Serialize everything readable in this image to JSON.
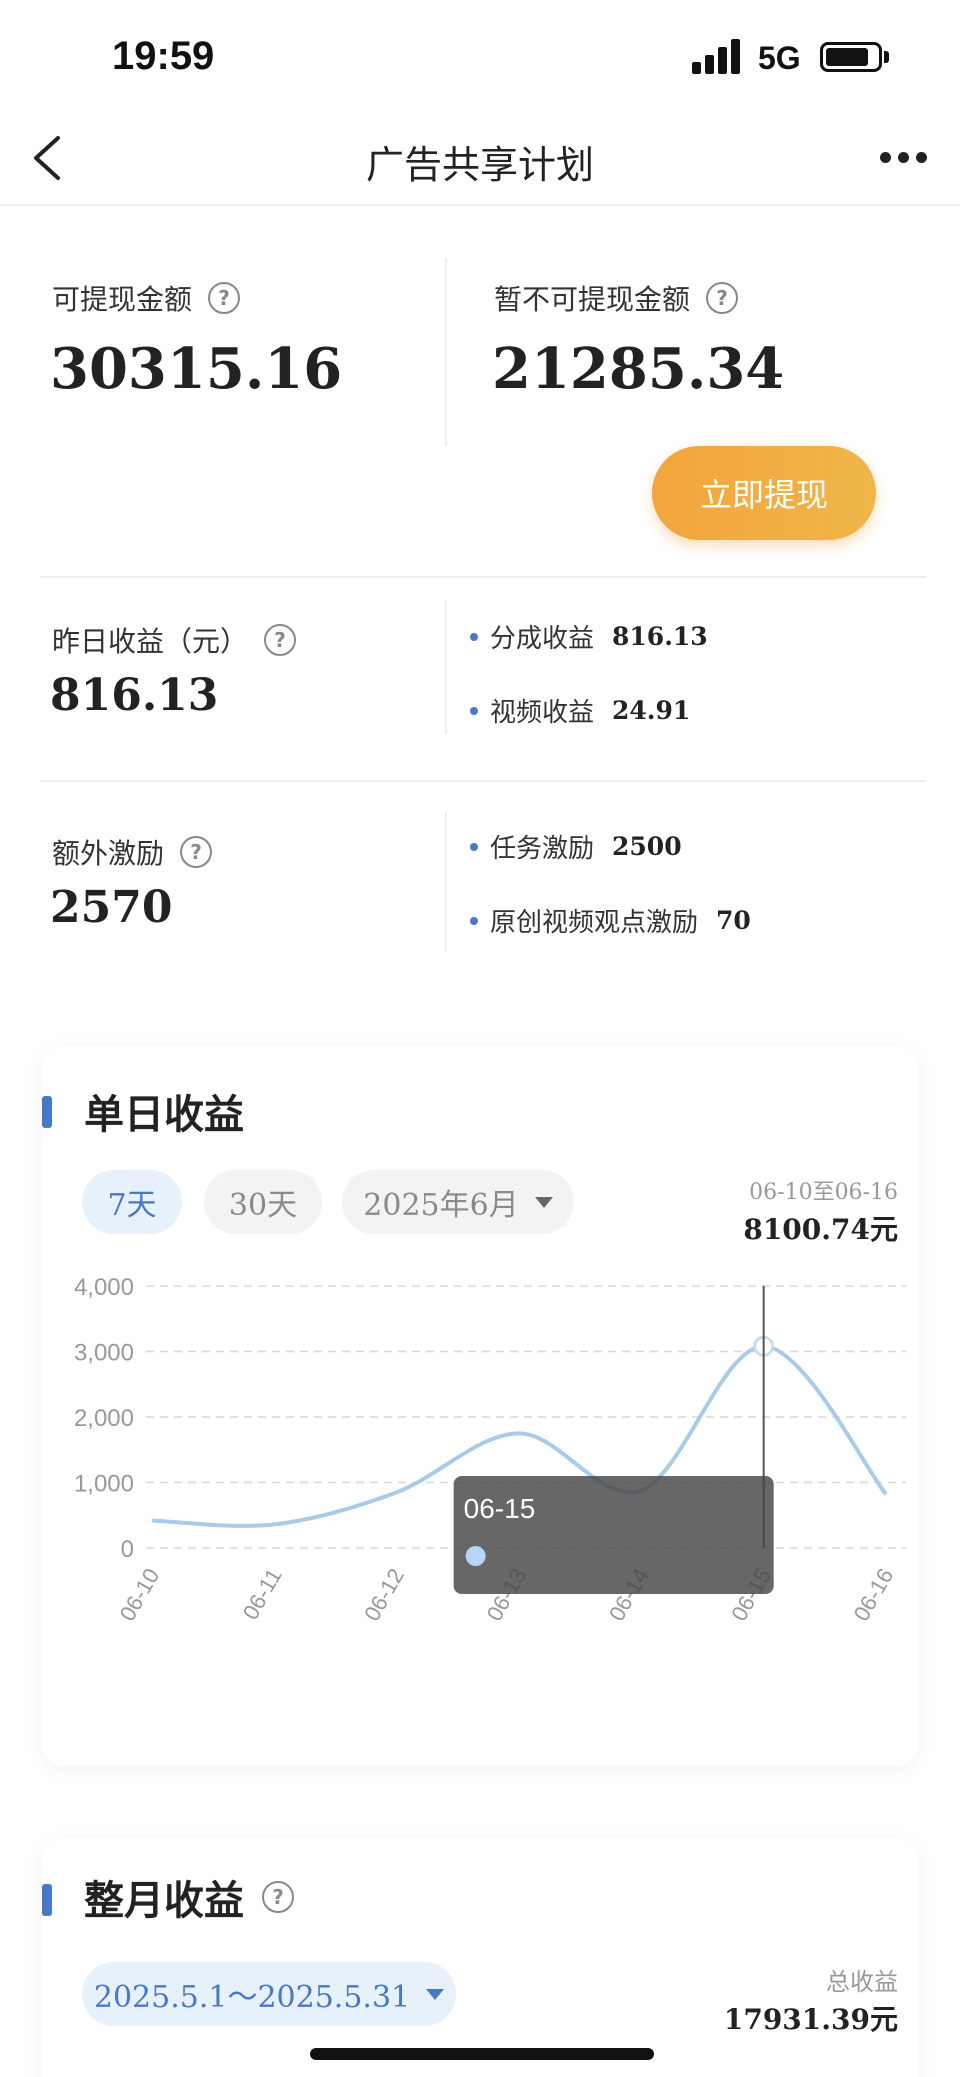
{
  "status": {
    "time": "19:59",
    "network": "5G"
  },
  "nav": {
    "title": "广告共享计划"
  },
  "balance": {
    "withdrawable_label": "可提现金额",
    "withdrawable_value": "30315.16",
    "pending_label": "暂不可提现金额",
    "pending_value": "21285.34",
    "withdraw_button": "立即提现"
  },
  "yesterday": {
    "label": "昨日收益（元）",
    "value": "816.13",
    "items": [
      {
        "label": "分成收益",
        "value": "816.13"
      },
      {
        "label": "视频收益",
        "value": "24.91"
      }
    ]
  },
  "extra": {
    "label": "额外激励",
    "value": "2570",
    "items": [
      {
        "label": "任务激励",
        "value": "2500"
      },
      {
        "label": "原创视频观点激励",
        "value": "70"
      }
    ]
  },
  "daily": {
    "title": "单日收益",
    "filters": [
      "7天",
      "30天"
    ],
    "month_select": "2025年6月",
    "range": "06-10至06-16",
    "total": "8100.74元",
    "tooltip_date": "06-15"
  },
  "monthly": {
    "title": "整月收益",
    "range_select": "2025.5.1～2025.5.31",
    "total_label": "总收益",
    "total_value": "17931.39元"
  },
  "chart_data": {
    "type": "line",
    "x": [
      "06-10",
      "06-11",
      "06-12",
      "06-13",
      "06-14",
      "06-15",
      "06-16"
    ],
    "series": [
      {
        "values": [
          420,
          360,
          850,
          1750,
          880,
          3080,
          820
        ]
      }
    ],
    "yticks": [
      "0",
      "1,000",
      "2,000",
      "3,000",
      "4,000"
    ],
    "ylim": [
      0,
      4000
    ],
    "grid": true,
    "line_color": "#a9cbea",
    "highlight_index": 5
  }
}
